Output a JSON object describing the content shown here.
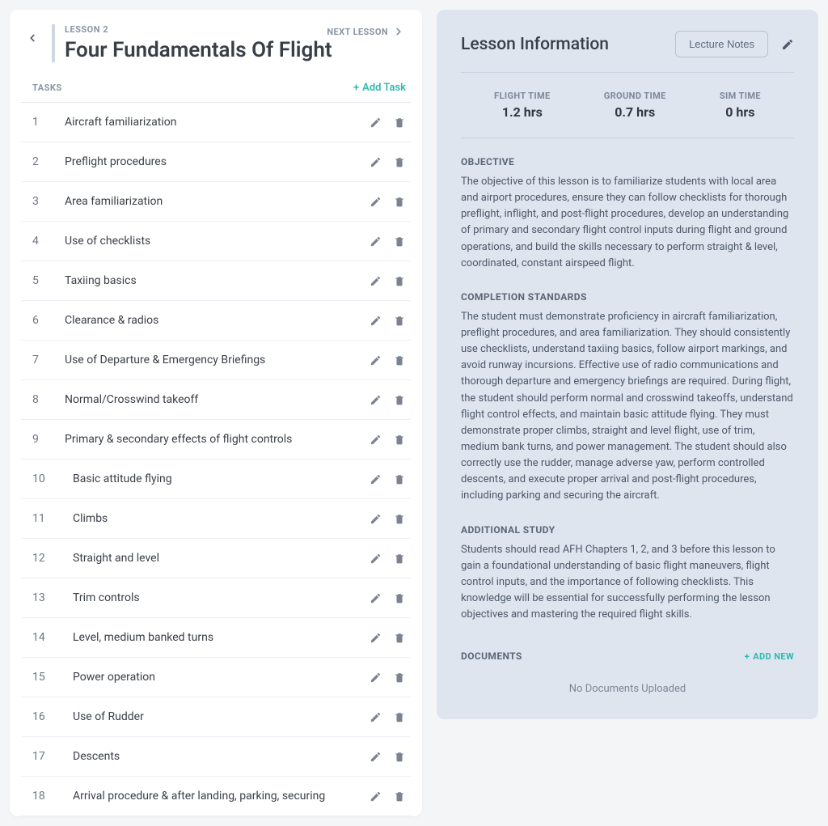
{
  "header": {
    "eyebrow": "LESSON 2",
    "title": "Four Fundamentals Of Flight",
    "next": "NEXT LESSON"
  },
  "tasks_label": "TASKS",
  "add_task_label": "Add Task",
  "tasks": [
    {
      "num": "1",
      "title": "Aircraft familiarization"
    },
    {
      "num": "2",
      "title": "Preflight procedures"
    },
    {
      "num": "3",
      "title": "Area familiarization"
    },
    {
      "num": "4",
      "title": "Use of checklists"
    },
    {
      "num": "5",
      "title": "Taxiing basics"
    },
    {
      "num": "6",
      "title": "Clearance & radios"
    },
    {
      "num": "7",
      "title": "Use of Departure & Emergency Briefings"
    },
    {
      "num": "8",
      "title": "Normal/Crosswind takeoff"
    },
    {
      "num": "9",
      "title": "Primary & secondary effects of flight controls"
    },
    {
      "num": "10",
      "title": "Basic attitude flying"
    },
    {
      "num": "11",
      "title": "Climbs"
    },
    {
      "num": "12",
      "title": "Straight and level"
    },
    {
      "num": "13",
      "title": "Trim controls"
    },
    {
      "num": "14",
      "title": "Level, medium banked turns"
    },
    {
      "num": "15",
      "title": "Power operation"
    },
    {
      "num": "16",
      "title": "Use of Rudder"
    },
    {
      "num": "17",
      "title": "Descents"
    },
    {
      "num": "18",
      "title": "Arrival procedure & after landing, parking, securing"
    }
  ],
  "info": {
    "title": "Lesson Information",
    "lecture_notes_label": "Lecture Notes",
    "times": {
      "flight_label": "FLIGHT TIME",
      "flight_value": "1.2 hrs",
      "ground_label": "GROUND TIME",
      "ground_value": "0.7 hrs",
      "sim_label": "SIM TIME",
      "sim_value": "0 hrs"
    },
    "objective_label": "OBJECTIVE",
    "objective_body": "The objective of this lesson is to familiarize students with local area and airport procedures, ensure they can follow checklists for thorough preflight, inflight, and post-flight procedures, develop an understanding of primary and secondary flight control inputs during flight and ground operations, and build the skills necessary to perform straight & level, coordinated, constant airspeed flight.",
    "completion_label": "COMPLETION STANDARDS",
    "completion_body": "The student must demonstrate proficiency in aircraft familiarization, preflight procedures, and area familiarization. They should consistently use checklists, understand taxiing basics, follow airport markings, and avoid runway incursions. Effective use of radio communications and thorough departure and emergency briefings are required. During flight, the student should perform normal and crosswind takeoffs, understand flight control effects, and maintain basic attitude flying. They must demonstrate proper climbs, straight and level flight, use of trim, medium bank turns, and power management. The student should also correctly use the rudder, manage adverse yaw, perform controlled descents, and execute proper arrival and post-flight procedures, including parking and securing the aircraft.",
    "additional_label": "ADDITIONAL STUDY",
    "additional_body": "Students should read AFH Chapters 1, 2, and 3 before this lesson to gain a foundational understanding of basic flight maneuvers, flight control inputs, and the importance of following checklists. This knowledge will be essential for successfully performing the lesson objectives and mastering the required flight skills.",
    "documents_label": "DOCUMENTS",
    "add_new_label": "ADD NEW",
    "documents_empty": "No Documents Uploaded"
  }
}
